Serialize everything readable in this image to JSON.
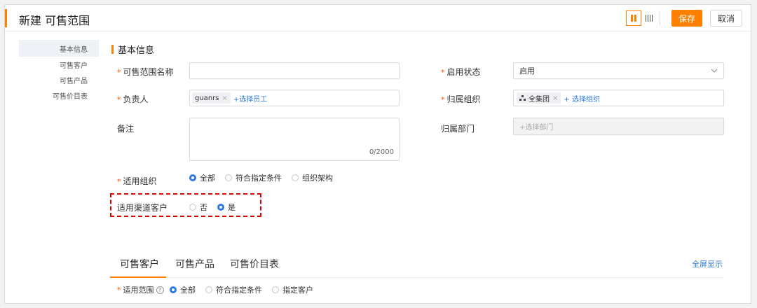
{
  "header": {
    "title": "新建 可售范围",
    "save_label": "保存",
    "cancel_label": "取消"
  },
  "nav": {
    "items": [
      {
        "label": "基本信息",
        "active": true
      },
      {
        "label": "可售客户"
      },
      {
        "label": "可售产品"
      },
      {
        "label": "可售价目表"
      }
    ]
  },
  "section": {
    "title": "基本信息"
  },
  "form": {
    "required_mark": "*",
    "range_name": {
      "label": "可售范围名称",
      "value": ""
    },
    "status": {
      "label": "启用状态",
      "value": "启用"
    },
    "owner": {
      "label": "负责人",
      "tag": "guanrs",
      "tag_remove": "×",
      "add_link": "+选择员工"
    },
    "org": {
      "label": "归属组织",
      "tag": "全集团",
      "tag_remove": "×",
      "add_link": "+ 选择组织"
    },
    "remark": {
      "label": "备注",
      "counter": "0/2000"
    },
    "dept": {
      "label": "归属部门",
      "placeholder": "+选择部门"
    },
    "applicable_org": {
      "label": "适用组织",
      "options": [
        "全部",
        "符合指定条件",
        "组织架构"
      ],
      "selected": "全部"
    },
    "channel_customer": {
      "label": "适用渠道客户",
      "options": [
        "否",
        "是"
      ],
      "selected": "是"
    }
  },
  "tabs": {
    "items": [
      "可售客户",
      "可售产品",
      "可售价目表"
    ],
    "active": "可售客户",
    "fullscreen_label": "全屏显示"
  },
  "scope": {
    "label": "适用范围",
    "help_glyph": "?",
    "options": [
      "全部",
      "符合指定条件",
      "指定客户"
    ],
    "selected": "全部"
  },
  "colors": {
    "accent": "#ff8000",
    "link": "#2f7bdc",
    "required": "#ff4d00",
    "highlight": "#e00000"
  }
}
